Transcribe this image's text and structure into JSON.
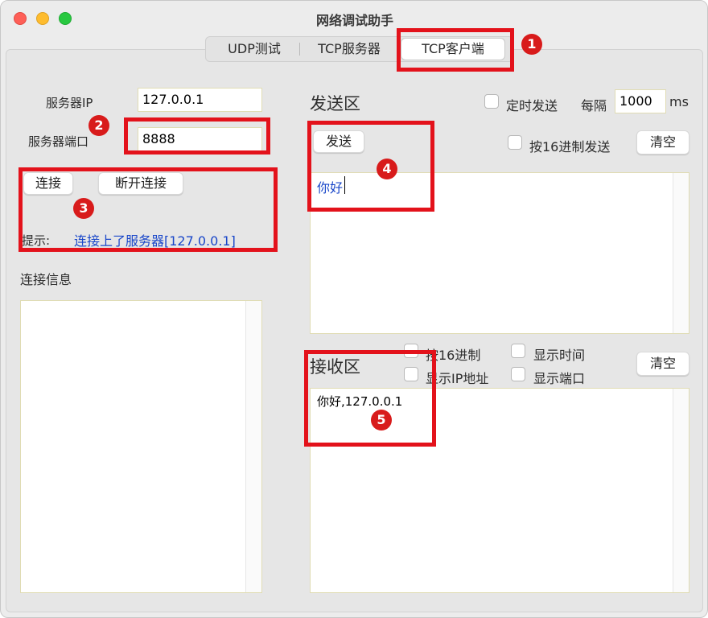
{
  "window": {
    "title": "网络调试助手"
  },
  "tabs": [
    {
      "label": "UDP测试"
    },
    {
      "label": "TCP服务器"
    },
    {
      "label": "TCP客户端"
    }
  ],
  "server": {
    "ip_label": "服务器IP",
    "ip_value": "127.0.0.1",
    "port_label": "服务器端口",
    "port_value": "8888"
  },
  "connection": {
    "connect_label": "连接",
    "disconnect_label": "断开连接",
    "hint_label": "提示:",
    "hint_text": "连接上了服务器[127.0.0.1]",
    "info_label": "连接信息"
  },
  "send": {
    "title": "发送区",
    "timed_send_label": "定时发送",
    "interval_label": "每隔",
    "interval_value": "1000",
    "interval_unit": "ms",
    "send_label": "发送",
    "hex_send_label": "按16进制发送",
    "clear_label": "清空",
    "text": "你好"
  },
  "receive": {
    "title": "接收区",
    "hex_label": "按16进制",
    "show_time_label": "显示时间",
    "show_ip_label": "显示IP地址",
    "show_port_label": "显示端口",
    "clear_label": "清空",
    "text": "你好,127.0.0.1"
  },
  "annotations": [
    "1",
    "2",
    "3",
    "4",
    "5"
  ],
  "colors": {
    "red": "#e3121b",
    "link_blue": "#1a47c9"
  }
}
